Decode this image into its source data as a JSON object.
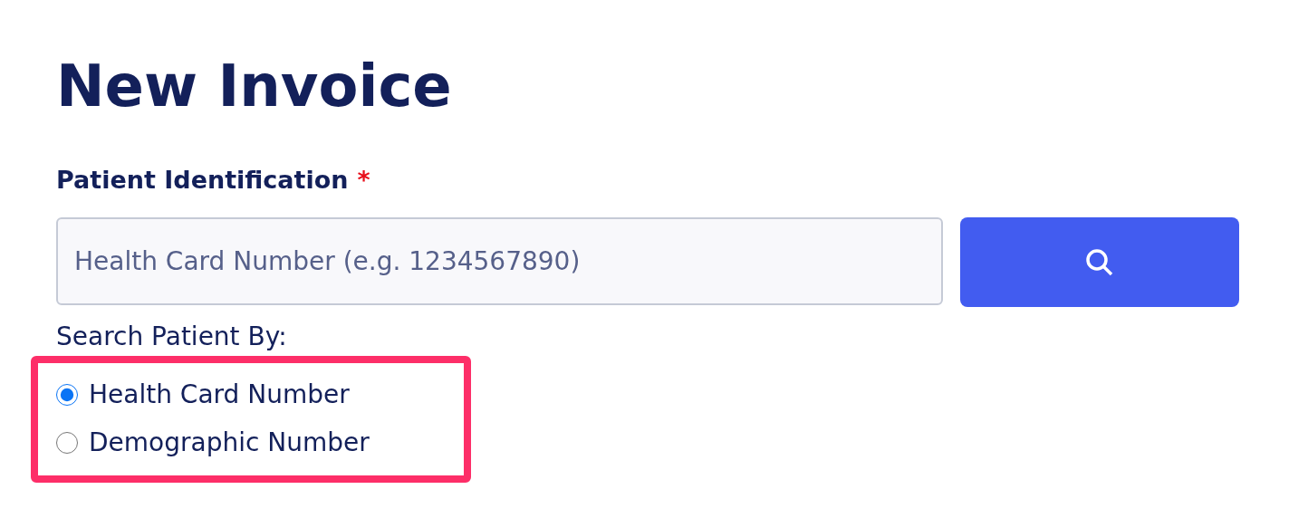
{
  "title": "New Invoice",
  "patient_identification": {
    "label": "Patient Identification",
    "required_mark": "*",
    "placeholder": "Health Card Number (e.g. 1234567890)"
  },
  "search_by": {
    "label": "Search Patient By:",
    "highlighted": true,
    "options": [
      {
        "label": "Health Card Number",
        "selected": true
      },
      {
        "label": "Demographic Number",
        "selected": false
      }
    ]
  }
}
